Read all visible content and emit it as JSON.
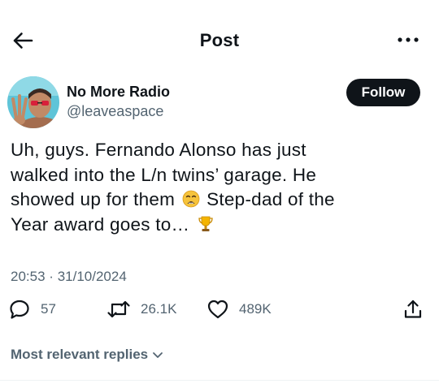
{
  "header": {
    "title": "Post",
    "back_icon": "arrow-left-icon",
    "more_icon": "more-horizontal-icon"
  },
  "author": {
    "display_name": "No More Radio",
    "handle": "@leaveaspace",
    "follow_label": "Follow"
  },
  "tweet": {
    "line1": "Uh, guys. Fernando Alonso has just",
    "line2": "walked into the L/n twins’ garage. He",
    "line3_before": "showed up for them",
    "line3_after": "Step-dad of the",
    "line4": "Year award goes to…",
    "emoji_1": "weary-face-emoji",
    "emoji_2": "trophy-emoji"
  },
  "meta": {
    "time": "20:53",
    "separator": "·",
    "date": "31/10/2024"
  },
  "actions": {
    "replies": "57",
    "reposts": "26.1K",
    "likes": "489K"
  },
  "replies_sort": {
    "label": "Most relevant replies"
  },
  "colors": {
    "text": "#0f1419",
    "secondary": "#536471",
    "follow_bg": "#0f1419",
    "divider": "#eff3f4"
  }
}
